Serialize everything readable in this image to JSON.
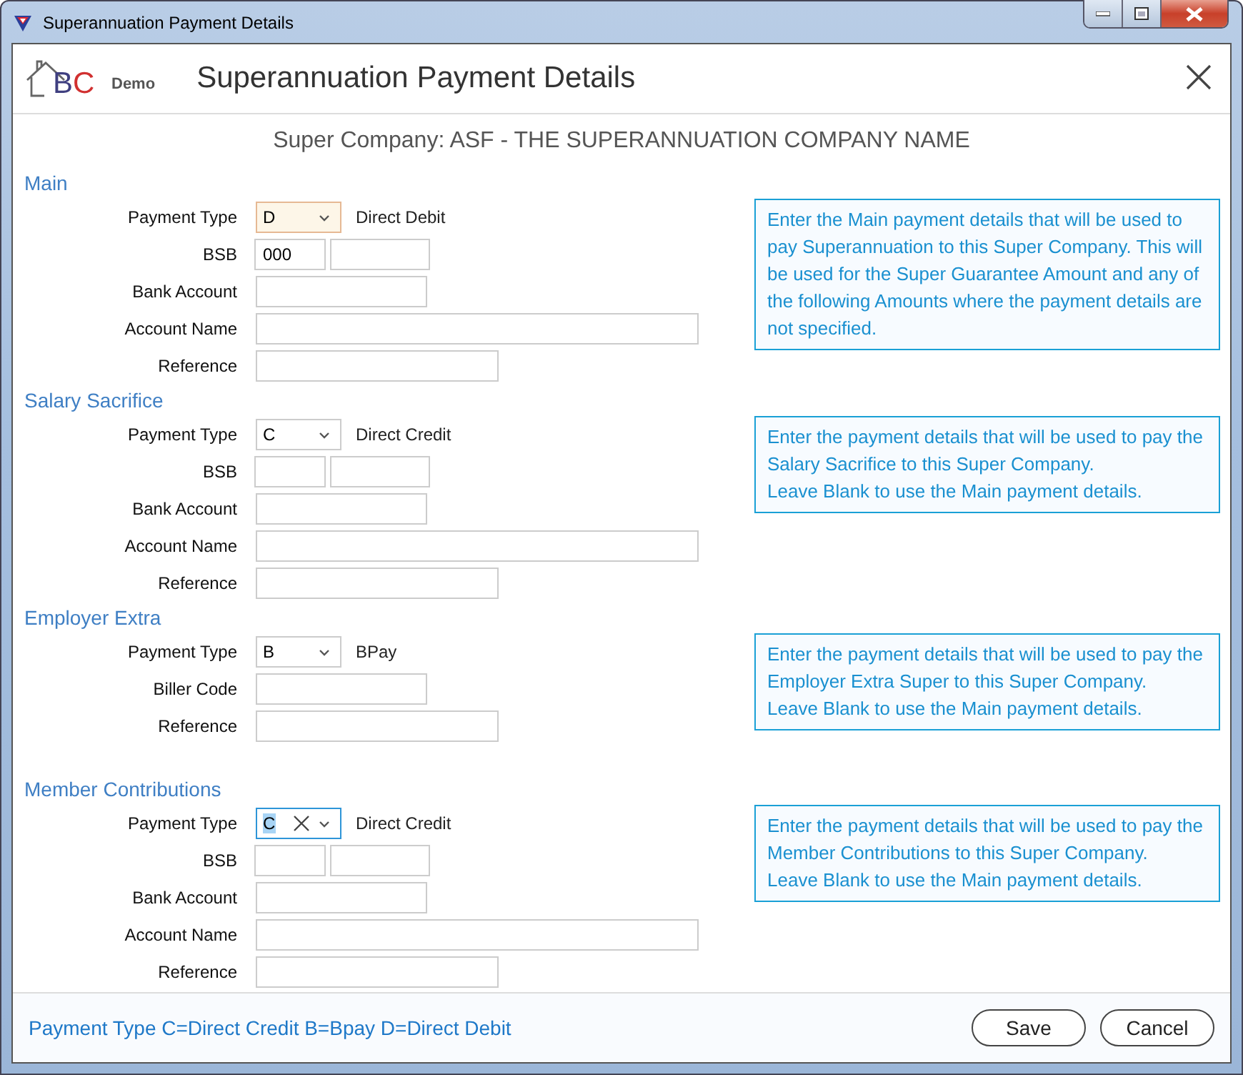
{
  "window": {
    "title": "Superannuation Payment Details"
  },
  "header": {
    "logo_letters": "BC",
    "logo_edition": "Demo",
    "title": "Superannuation Payment Details"
  },
  "subtitle": "Super Company: ASF - THE SUPERANNUATION COMPANY NAME",
  "sections": [
    {
      "heading": "Main",
      "info": [
        "Enter the Main payment details that will be used to pay Superannuation to this Super Company. This will be used for the Super Guarantee Amount and any of the following Amounts where the payment details are not specified."
      ],
      "rows": [
        {
          "label": "Payment Type",
          "kind": "combo",
          "value": "D",
          "description": "Direct Debit",
          "highlighted": true,
          "focused": false
        },
        {
          "label": "BSB",
          "kind": "split",
          "value": "000"
        },
        {
          "label": "Bank Account",
          "kind": "medium"
        },
        {
          "label": "Account Name",
          "kind": "long"
        },
        {
          "label": "Reference",
          "kind": "wide"
        }
      ]
    },
    {
      "heading": "Salary Sacrifice",
      "info": [
        "Enter the payment details that will be used to pay the Salary Sacrifice to this Super Company.",
        "Leave Blank to use the Main payment details."
      ],
      "rows": [
        {
          "label": "Payment Type",
          "kind": "combo",
          "value": "C",
          "description": "Direct Credit",
          "highlighted": false,
          "focused": false
        },
        {
          "label": "BSB",
          "kind": "split"
        },
        {
          "label": "Bank Account",
          "kind": "medium"
        },
        {
          "label": "Account Name",
          "kind": "long"
        },
        {
          "label": "Reference",
          "kind": "wide"
        }
      ]
    },
    {
      "heading": "Employer Extra",
      "info": [
        "Enter the payment details that will be used to pay the Employer Extra Super to this Super Company.",
        "Leave Blank to use the Main payment details."
      ],
      "rows": [
        {
          "label": "Payment Type",
          "kind": "combo",
          "value": "B",
          "description": "BPay",
          "highlighted": false,
          "focused": false
        },
        {
          "label": "Biller Code",
          "kind": "medium"
        },
        {
          "label": "Reference",
          "kind": "wide"
        }
      ]
    },
    {
      "heading": "Member Contributions",
      "info": [
        "Enter the payment details that will be used to pay the Member Contributions to this Super Company.",
        "Leave Blank to use the Main payment details."
      ],
      "rows": [
        {
          "label": "Payment Type",
          "kind": "combo",
          "value": "C",
          "description": "Direct Credit",
          "highlighted": false,
          "focused": true
        },
        {
          "label": "BSB",
          "kind": "split"
        },
        {
          "label": "Bank Account",
          "kind": "medium"
        },
        {
          "label": "Account Name",
          "kind": "long"
        },
        {
          "label": "Reference",
          "kind": "wide"
        }
      ]
    }
  ],
  "footer": {
    "legend": "Payment Type C=Direct Credit B=Bpay D=Direct Debit",
    "buttons": [
      "Save",
      "Cancel"
    ]
  }
}
